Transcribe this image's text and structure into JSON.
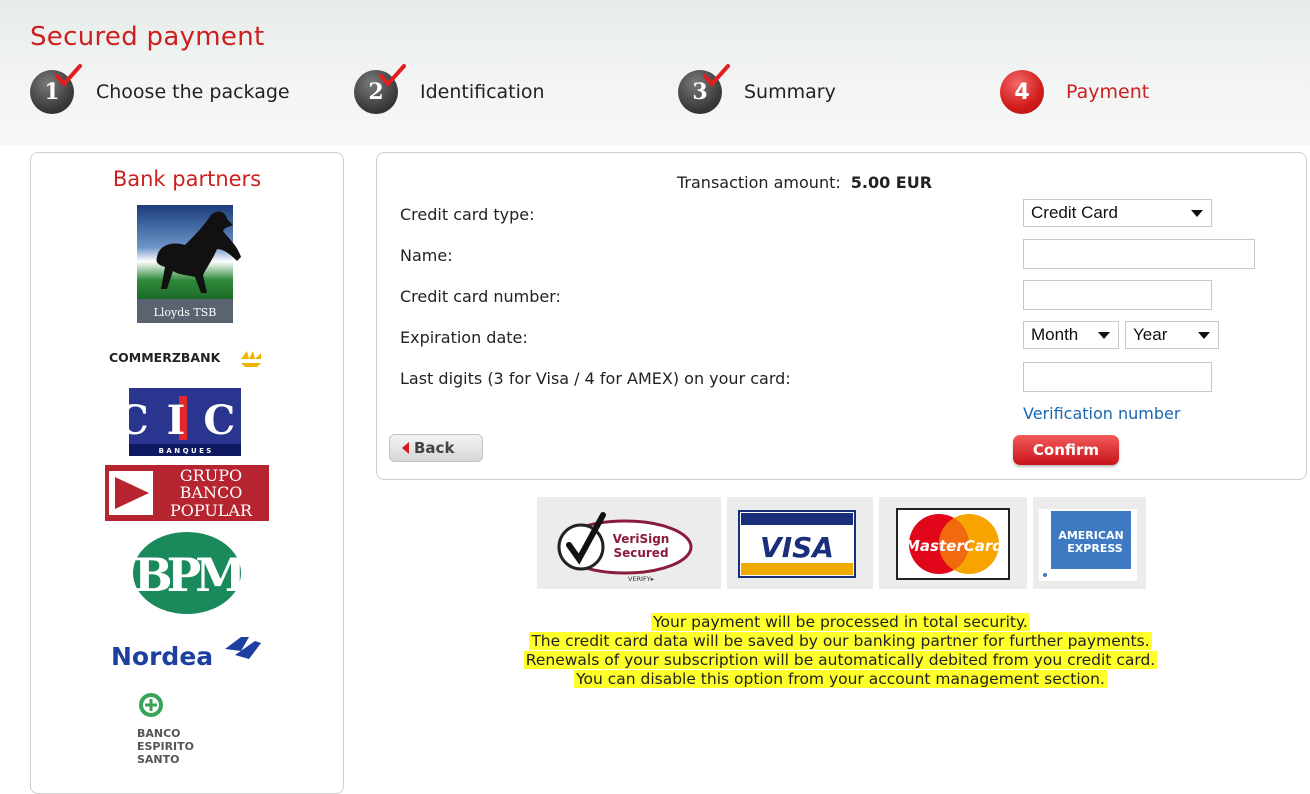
{
  "page": {
    "title": "Secured payment"
  },
  "steps": [
    {
      "number": "1",
      "label": "Choose the package",
      "status": "done"
    },
    {
      "number": "2",
      "label": "Identification",
      "status": "done"
    },
    {
      "number": "3",
      "label": "Summary",
      "status": "done"
    },
    {
      "number": "4",
      "label": "Payment",
      "status": "active"
    }
  ],
  "partners": {
    "title": "Bank partners",
    "logos": {
      "lloyds": "Lloyds TSB",
      "commerzbank": "COMMERZBANK",
      "cic_main": "CIC",
      "cic_sub": "B A N Q U E S",
      "popular_1": "GRUPO",
      "popular_2": "BANCO",
      "popular_3": "POPULAR",
      "bpm": "BPM",
      "nordea": "Nordea",
      "bes_1": "BANCO",
      "bes_2": "ESPIRITO",
      "bes_3": "SANTO"
    }
  },
  "form": {
    "amount_label": "Transaction amount:",
    "amount_value": "5.00 EUR",
    "card_type_label": "Credit card type:",
    "card_type_value": "Credit Card",
    "name_label": "Name:",
    "name_value": "",
    "number_label": "Credit card number:",
    "number_value": "",
    "expiration_label": "Expiration date:",
    "month_value": "Month",
    "year_value": "Year",
    "cvv_label": "Last digits (3 for Visa / 4 for AMEX) on your card:",
    "cvv_value": "",
    "verification_link": "Verification number",
    "back_label": "Back",
    "confirm_label": "Confirm"
  },
  "card_logos": {
    "verisign_1": "VeriSign",
    "verisign_2": "Secured",
    "verisign_3": "VERIFY▸",
    "visa": "VISA",
    "mastercard": "MasterCard",
    "amex_1": "AMERICAN",
    "amex_2": "EXPRESS"
  },
  "notice": [
    "Your payment will be processed in total security.",
    "The credit card data will be saved by our banking partner for further payments.",
    "Renewals of your subscription will be automatically debited from you credit card.",
    "You can disable this option from your account management section."
  ],
  "colors": {
    "accent": "#cc1f1f",
    "link": "#1a66b0",
    "highlight": "#ffff2a"
  }
}
